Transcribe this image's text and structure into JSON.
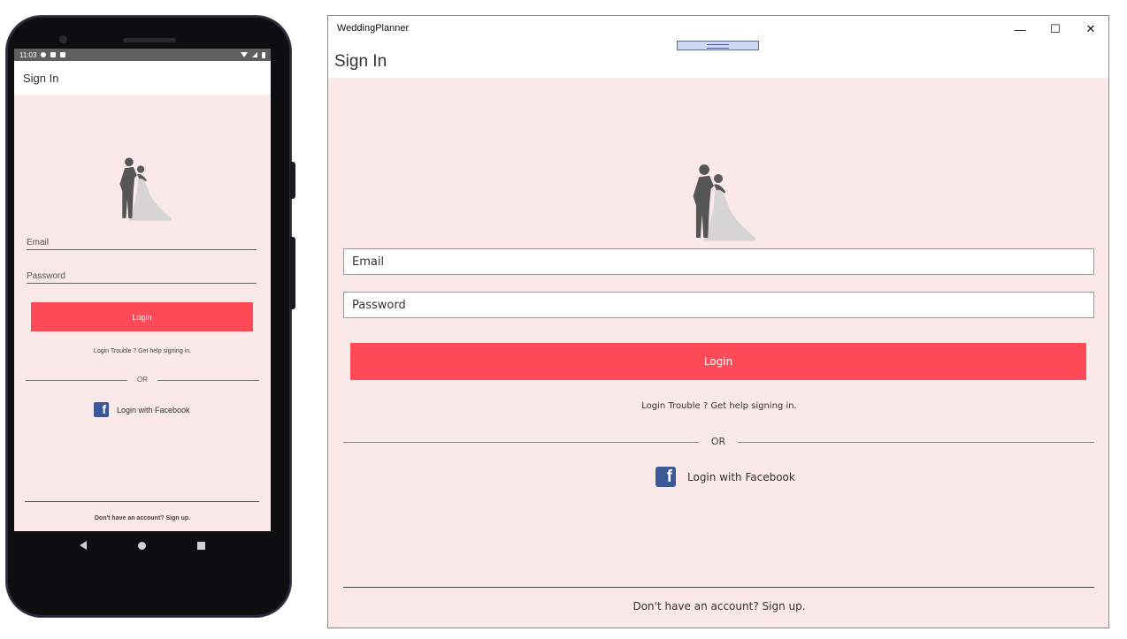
{
  "mobile": {
    "status_time": "11:03",
    "header_title": "Sign In",
    "email_placeholder": "Email",
    "password_placeholder": "Password",
    "login_label": "Login",
    "trouble_text": "Login Trouble ? Get help signing in.",
    "or_text": "OR",
    "facebook_label": "Login with Facebook",
    "signup_text": "Don't have an account? Sign up."
  },
  "desktop": {
    "app_title": "WeddingPlanner",
    "header_title": "Sign In",
    "email_placeholder": "Email",
    "password_placeholder": "Password",
    "login_label": "Login",
    "trouble_text": "Login Trouble ? Get help signing in.",
    "or_text": "OR",
    "facebook_label": "Login with Facebook",
    "signup_text": "Don't have an account? Sign up."
  },
  "icons": {
    "logo": "wedding-couple-icon",
    "facebook": "facebook-icon",
    "facebook_glyph": "f",
    "minimize": "—",
    "maximize": "☐",
    "close": "✕"
  },
  "colors": {
    "background": "#fbe8e8",
    "accent": "#ff4a58",
    "facebook": "#3b5998",
    "groom": "#555555",
    "bride": "#d6d4d4"
  }
}
